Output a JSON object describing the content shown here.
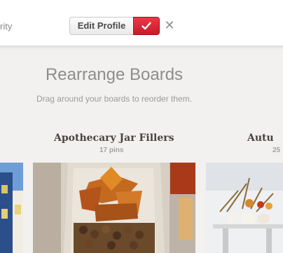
{
  "header": {
    "nav_partial": "rity",
    "edit_profile_label": "Edit Profile",
    "done_icon": "checkmark-icon",
    "close_icon": "close-icon",
    "accent_color": "#d2212f"
  },
  "main": {
    "title": "Rearrange Boards",
    "subtitle": "Drag around your boards to reorder them."
  },
  "boards": [
    {
      "title": "Apothecary Jar Fillers",
      "count": "17 pins"
    },
    {
      "title": "Autu",
      "count": "25"
    }
  ]
}
